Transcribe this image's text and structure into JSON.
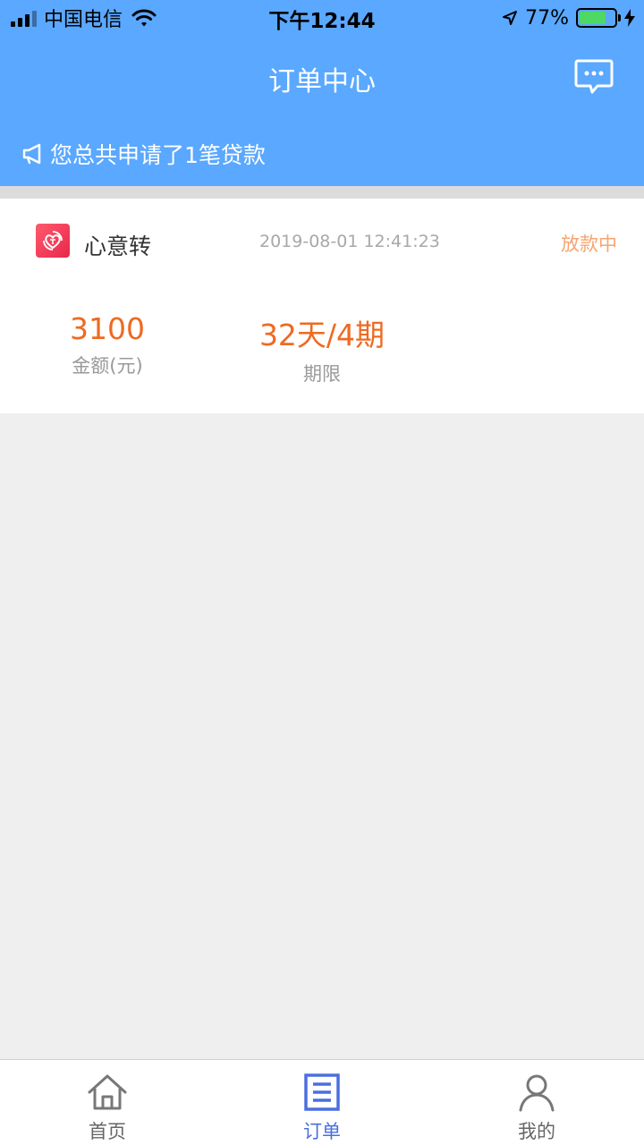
{
  "status_bar": {
    "carrier": "中国电信",
    "time": "下午12:44",
    "battery": "77%",
    "battery_level": 0.77
  },
  "header": {
    "title": "订单中心",
    "notice": "您总共申请了1笔贷款"
  },
  "order": {
    "product_name": "心意转",
    "time": "2019-08-01 12:41:23",
    "status": "放款中",
    "amount_value": "3100",
    "amount_label": "金额(元)",
    "term_value": "32天/4期",
    "term_label": "期限"
  },
  "tabbar": {
    "items": [
      {
        "label": "首页",
        "icon": "home-icon",
        "active": false
      },
      {
        "label": "订单",
        "icon": "order-list-icon",
        "active": true
      },
      {
        "label": "我的",
        "icon": "profile-icon",
        "active": false
      }
    ]
  },
  "colors": {
    "header_bg": "#5aa8ff",
    "accent_orange": "#ee6a22",
    "status_orange": "#f5a572",
    "tab_active": "#4a6fe0"
  }
}
